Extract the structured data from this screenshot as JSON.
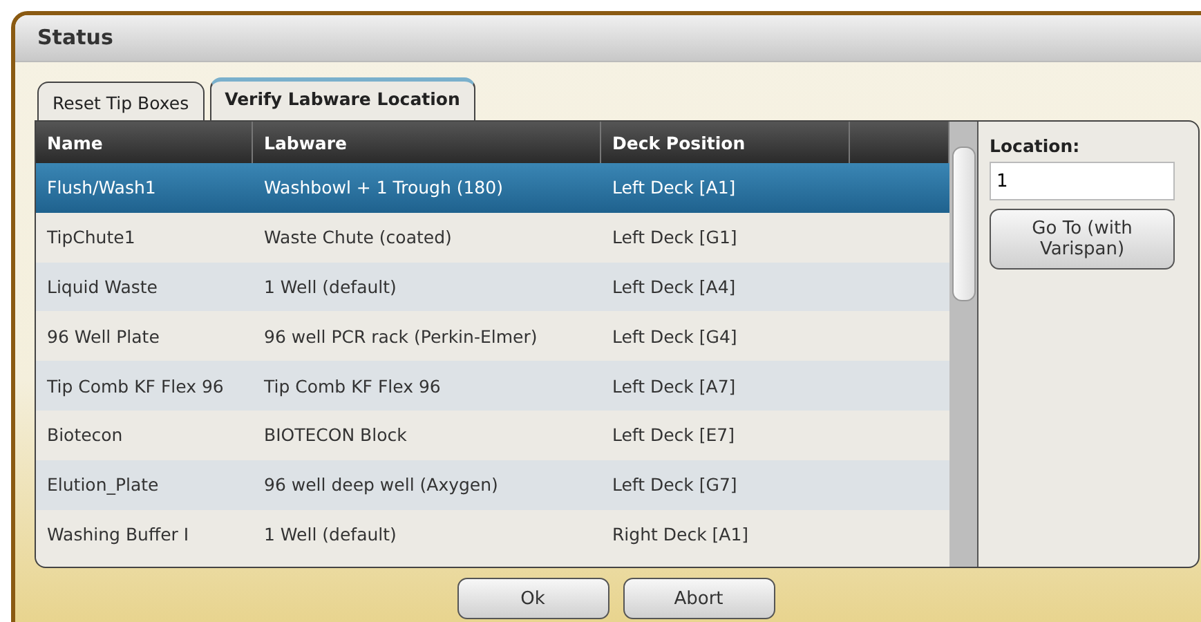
{
  "window": {
    "title": "Status"
  },
  "tabs": [
    {
      "label": "Reset Tip Boxes",
      "selected": false
    },
    {
      "label": "Verify Labware Location",
      "selected": true
    }
  ],
  "table": {
    "columns": [
      "Name",
      "Labware",
      "Deck Position"
    ],
    "rows": [
      {
        "cells": [
          "Flush/Wash1",
          "Washbowl + 1 Trough (180)",
          "Left Deck [A1]"
        ],
        "selected": true
      },
      {
        "cells": [
          "TipChute1",
          "Waste Chute (coated)",
          "Left Deck [G1]"
        ],
        "selected": false
      },
      {
        "cells": [
          "Liquid Waste",
          "1 Well (default)",
          "Left Deck [A4]"
        ],
        "selected": false
      },
      {
        "cells": [
          "96 Well Plate",
          "96 well PCR rack (Perkin-Elmer)",
          "Left Deck [G4]"
        ],
        "selected": false
      },
      {
        "cells": [
          "Tip Comb KF Flex 96",
          "Tip Comb KF Flex 96",
          "Left Deck [A7]"
        ],
        "selected": false
      },
      {
        "cells": [
          "Biotecon",
          "BIOTECON Block",
          "Left Deck [E7]"
        ],
        "selected": false
      },
      {
        "cells": [
          "Elution_Plate",
          "96 well deep well (Axygen)",
          "Left Deck [G7]"
        ],
        "selected": false
      },
      {
        "cells": [
          "Washing Buffer I",
          "1 Well (default)",
          "Right Deck [A1]"
        ],
        "selected": false
      }
    ]
  },
  "location": {
    "label": "Location:",
    "value": "1",
    "button": "Go To (with Varispan)"
  },
  "buttons": [
    "Ok",
    "Abort"
  ]
}
